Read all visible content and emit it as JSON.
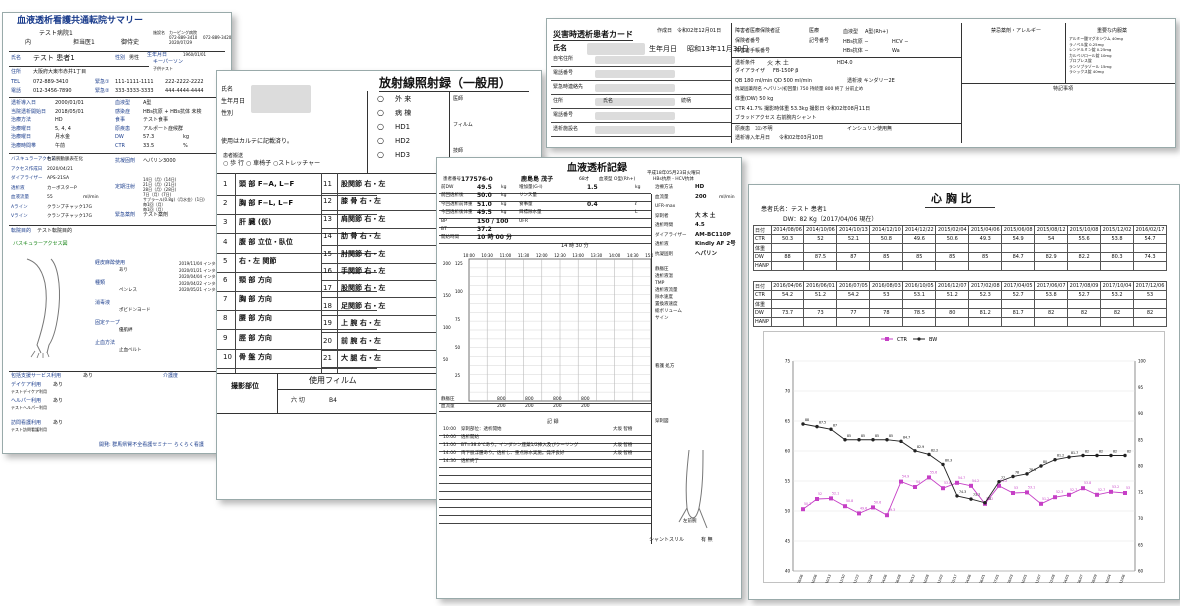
{
  "summary": {
    "title": "血液透析看護共通転院サマリー",
    "ids": [
      "フリガナ",
      "テスト病院1",
      "内",
      "担当医1",
      "御侍史"
    ],
    "hospital_label": "施設名",
    "hospital": "カーピング病院",
    "tel_label": "TEL",
    "tel": "072-889-3410",
    "fax_label": "FAX",
    "fax": "072-889-3420",
    "date_label": "記入日",
    "date": "2020/07/29",
    "writer_label": "記入者",
    "writer": "看師",
    "name_label": "氏名",
    "name": "テスト 患者1",
    "sex_label": "性別",
    "sex": "男性",
    "birth_label": "生年月日",
    "birth": "1960/01/01",
    "age": "60",
    "age_unit": "歳",
    "keyperson": "キーパーソン",
    "keyperson_val": "子供テスト",
    "address_label": "住所",
    "address": "大阪府大東市赤井1丁目",
    "tel2_label": "TEL",
    "tel2": "072-889-3410",
    "emerg_label": "緊急①",
    "emerg1": "111-1111-1111",
    "emerg1b": "222-2222-2222",
    "phone_label": "電話",
    "phone": "012-3456-7890",
    "emerg2_label": "緊急②",
    "emerg2": "333-3333-3333",
    "emerg2b": "444-4444-4444",
    "rows_left": [
      {
        "k": "透析導入日",
        "v": "2000/01/01"
      },
      {
        "k": "当院透析開始日",
        "v": "2018/05/01"
      },
      {
        "k": "治療方法",
        "v": "HD"
      },
      {
        "k": "治療曜日",
        "v": "5, 4, 4"
      },
      {
        "k": "治療曜日",
        "v": "月水金"
      },
      {
        "k": "治療時間帯",
        "v": "午前"
      }
    ],
    "rows_right": [
      {
        "k": "血液型",
        "v": "A型"
      },
      {
        "k": "感染症",
        "v": "HBs抗原 + HBs抗体 未検"
      },
      {
        "k": "食事",
        "v": "テスト食事"
      },
      {
        "k": "原疾患",
        "v": "アルポート症候群"
      },
      {
        "k": "DW",
        "v": "57.3",
        "u": "kg"
      },
      {
        "k": "CTR",
        "v": "33.5",
        "u": "%"
      }
    ],
    "access_section": [
      {
        "k": "バスキュラーアクセス",
        "v": "右前腕動脈表在化"
      },
      {
        "k": "アクセス作成日",
        "v": "2020/04/21"
      },
      {
        "k": "ダイアライザー",
        "v": "APS-21SA"
      },
      {
        "k": "透析液",
        "v": "カーボスターP"
      },
      {
        "k": "血液流量",
        "v": "55",
        "u": "ml/min"
      },
      {
        "k": "Aライン",
        "v": "クランプチャック17G"
      },
      {
        "k": "Vライン",
        "v": "クランプチャック17G"
      }
    ],
    "anticoag_label": "抗凝固剤",
    "anticoag": "ヘパリン3000",
    "fixed_label": "定期注射",
    "emerg_drug_label": "緊急薬剤",
    "emerg_drug": "テスト薬剤",
    "injections": [
      "14日（月）(14日)",
      "21日（月）(21日)",
      "28日（月）(28日)",
      "7日（月）(7日)",
      "サブラール(0.8g)（月水金）(1日)",
      "毎1回（月）",
      "毎1回（月）"
    ],
    "transfer_label": "転院目的",
    "transfer_note": "テスト転院目的",
    "vascular_label": "バスキュラーアクセス図",
    "access_list": [
      {
        "k": "経皮麻酔使用",
        "v": "あり"
      },
      {
        "k": "種類",
        "v": "ペンレス"
      },
      {
        "k": "消毒液",
        "v": "ポビドンヨード"
      },
      {
        "k": "固定テープ",
        "v": "優肌絆"
      },
      {
        "k": "止血方法",
        "v": "止血ベルト"
      }
    ],
    "access_dates": [
      "2019/11/04 インターベンショナル",
      "2020/01/21 インターベンショナル",
      "2020/04/04 インターベンショナル",
      "2020/04/22 インターベンショナル",
      "2020/05/21 インターベンショナル"
    ],
    "service_label": "包括支援サービス利用",
    "service_val": "あり",
    "care_label": "介護度",
    "day_care_label": "デイケア利用",
    "day_care_val": "あり",
    "day_care_note": "テストデイケア利用",
    "helper_label": "ヘルパー利用",
    "helper_val": "あり",
    "helper_note": "テストヘルパー利用",
    "visit_label": "訪問看護利用",
    "visit_val": "あり",
    "visit_note": "テスト訪問看護利用",
    "footer": "開発: 群馬県腎不全看護セミナー らくらく看護"
  },
  "radiation": {
    "title": "放射線照射録（一般用）",
    "labels": [
      "氏名",
      "生年月日",
      "性別"
    ],
    "note": "使用はカルテに記載済り。",
    "transport_label": "患者搬送",
    "transport": "○ 歩 行  ○ 車椅子  ○ストレッチャー",
    "options": [
      "外 来",
      "病 棟",
      "HD1",
      "HD2",
      "HD3"
    ],
    "side_labels": [
      "医師",
      "フィルム",
      "技師"
    ],
    "rows_left": [
      {
        "n": "1",
        "t": "頭 部    F−A, L−F"
      },
      {
        "n": "2",
        "t": "胸 部    F−L, L−F"
      },
      {
        "n": "3",
        "t": "肝 臓 (仮)"
      },
      {
        "n": "4",
        "t": "腹 部  立位・臥位"
      },
      {
        "n": "5",
        "t": "右・左 関節"
      },
      {
        "n": "6",
        "t": "頸 部    方向"
      },
      {
        "n": "7",
        "t": "胸 部    方向"
      },
      {
        "n": "8",
        "t": "腰 部    方向"
      },
      {
        "n": "9",
        "t": "脛 部    方向"
      },
      {
        "n": "10",
        "t": "骨 盤    方向"
      }
    ],
    "rows_right": [
      {
        "n": "11",
        "t": "股関節  右・左"
      },
      {
        "n": "12",
        "t": "膝 骨  右・左"
      },
      {
        "n": "13",
        "t": "肩関節  右・左"
      },
      {
        "n": "14",
        "t": "肋 骨  右・左"
      },
      {
        "n": "15",
        "t": "肘関節  右・左"
      },
      {
        "n": "16",
        "t": "手関節  右・左"
      },
      {
        "n": "17",
        "t": "股関節  右・左"
      },
      {
        "n": "18",
        "t": "足関節  右・左"
      },
      {
        "n": "19",
        "t": "上 腕  右・左"
      },
      {
        "n": "20",
        "t": "前 腕  右・左"
      },
      {
        "n": "21",
        "t": "大 腿  右・左"
      }
    ],
    "film_label": "使用フィルム",
    "film_sizes": [
      "六 切",
      "B4"
    ],
    "film_side": "撮影部位"
  },
  "dialysis": {
    "title": "血液透析記録",
    "date": "平成18年05月23日火曜日",
    "patient_label": "患者番号",
    "patient_id": "177576-0",
    "patient_name": "鹿島島 茂子",
    "age": "68才",
    "blood": "血液型 O型(Rh+)",
    "infect": "HBs抗原 - HCV抗体",
    "rows": [
      {
        "k": "前DW",
        "v": "49.5",
        "u": "kg"
      },
      {
        "k": "前回透析後",
        "v": "50.0",
        "u": "kg"
      },
      {
        "k": "今回透析前体重",
        "v": "51.0",
        "u": "kg"
      },
      {
        "k": "今回透析後体重",
        "v": "49.5",
        "u": "kg"
      },
      {
        "k": "BP",
        "v": "150 / 100"
      },
      {
        "k": "BT",
        "v": "37.2"
      },
      {
        "k": "開始時間",
        "v": "10 時 00 分"
      }
    ],
    "mid": [
      {
        "k": "増加量(G-I)",
        "v": "1.5",
        "u": "kg"
      },
      {
        "k": "リンス量",
        "v": "",
        "u": ""
      },
      {
        "k": "食事量",
        "v": "0.4",
        "u": "ℓ"
      },
      {
        "k": "目標除水量",
        "v": "",
        "u": "L"
      },
      {
        "k": "UFR",
        "v": "",
        "u": ""
      }
    ],
    "right": [
      {
        "k": "治療方法",
        "v": "HD"
      },
      {
        "k": "血流量",
        "v": "200",
        "u": "ml/min"
      },
      {
        "k": "UFR-max",
        "v": ""
      },
      {
        "k": "穿刺者",
        "v": "大 木 土"
      },
      {
        "k": "透析時間",
        "v": "4.5"
      },
      {
        "k": "ダイアライザー",
        "v": "AM-BC110P"
      },
      {
        "k": "透析液",
        "v": "Kindly AF 2号"
      },
      {
        "k": "抗凝固剤",
        "v": "ヘパリン"
      }
    ],
    "end_time": "14 時 30 分",
    "times": [
      "10:00",
      "10:30",
      "11:00",
      "11:30",
      "12:00",
      "12:30",
      "13:00",
      "13:30",
      "14:00",
      "14:30",
      "15:00"
    ],
    "y_ticks_bp": [
      "200",
      "150",
      "100",
      "50"
    ],
    "y_ticks_hr": [
      "125",
      "100",
      "75",
      "50",
      "25"
    ],
    "flow_label": "血流量",
    "flow": [
      "200",
      "200",
      "200",
      "200"
    ],
    "press_label": "静脈圧",
    "press": [
      "800",
      "800",
      "800",
      "800"
    ],
    "side_items": [
      "静脈圧",
      "透析液温",
      "TMP",
      "透析液流量",
      "除水速度",
      "置換液速度",
      "総ボリューム",
      "サイン"
    ],
    "record_label": "記 録",
    "records": [
      {
        "t": "10:00",
        "v": "穿刺部位：透析開始",
        "who": "大坂 智樹"
      },
      {
        "t": "10:00",
        "v": "透析開始"
      },
      {
        "t": "11:00",
        "v": "BT=38.0℃あり。インダシン座薬1/2挿入及びクーリング",
        "who": "大坂 智樹"
      },
      {
        "t": "14:00",
        "v": "両下肢浮腫あり。透析し、重点除水実施。発汗良好",
        "who": "大坂 智樹"
      },
      {
        "t": "14:30",
        "v": "透析終了"
      }
    ],
    "note_label": "看護 処方",
    "arm_label": "穿刺図",
    "arm_side": "左前腕",
    "shunt_label": "シャントスリル",
    "shunt_val": "有 無"
  },
  "emergency": {
    "title": "災害時透析患者カード",
    "created_label": "作成日",
    "created": "令和02年12月01日",
    "name_label": "氏名",
    "birth_label": "生年月日",
    "birth": "昭和13年11月30日",
    "fields": [
      "自宅住所",
      "電話番号",
      "緊急時連絡先",
      "住所",
      "電話番号",
      "透析施設名"
    ],
    "contact_name_label": "氏名",
    "relation_label": "続柄",
    "insurance": [
      {
        "k": "障害者医療保険者証",
        "v": "医療"
      },
      {
        "k": "保険者番号",
        "v": "記号番号"
      },
      {
        "k": "障害者手帳番号",
        "v": ""
      }
    ],
    "blood_label": "血液型",
    "blood": "A型(Rh+)",
    "hbs": "HBs抗原 −",
    "hcv": "HCV −",
    "hbs2": "HBs抗体 −",
    "wa": "Wa",
    "cond_label": "透析条件",
    "cond": "火 木 土",
    "hd": "HD4.0",
    "dializer_label": "ダイアライザ",
    "dializer": "FB-150P β",
    "qb": "QB 180 ml/min QD 500 ml/min",
    "dialysate": "透析液 キンダリー2E",
    "anticoag": "抗凝固薬剤名 ヘパリン(初回量) 750 持続量 800 終了 分前止め",
    "dw": "体重(DW) 50 kg",
    "ctr": "CTR 41.7% 撮影時体重 53.3kg 撮影日 令和02年08月11日",
    "access": "ブラッドアクセス 右前腕内シャント",
    "disease_label": "原疾患",
    "disease": "ｺﾛﾝ不明",
    "start_label": "透析導入年月日",
    "start": "令和02年03月10日",
    "insulin_label": "インシュリン使用",
    "insulin": "無",
    "allergy_label": "禁忌薬剤・アレルギー",
    "important_label": "重要な内服薬",
    "meds": [
      "アルミー酸マグネシウム 40mg",
      "ラノベル錠 0.25mg",
      "レンドルミン錠 0.25mg",
      "カルベジロール錠 10mg",
      "ブロプレス錠",
      "ランソプラゾール 15mg",
      "ラシックス錠 40mg"
    ],
    "special_label": "特記事項"
  },
  "ctr": {
    "title": "心 胸 比",
    "patient": "患者氏名：テスト 患者1",
    "dw": "DW：82 Kg（2017/04/06 現在）",
    "row_labels": [
      "日付",
      "CTR",
      "体重",
      "DW",
      "HANP"
    ],
    "dates1": [
      "2014/08/06",
      "2014/10/06",
      "2014/10/13",
      "2014/12/10",
      "2014/12/22",
      "2015/02/04",
      "2015/04/06",
      "2015/06/08",
      "2015/08/12",
      "2015/10/08",
      "2015/12/02",
      "2016/02/17"
    ],
    "ctr1": [
      "50.3",
      "52",
      "52.1",
      "50.8",
      "49.6",
      "50.6",
      "49.3",
      "54.9",
      "54",
      "55.6",
      "53.8",
      "54.7"
    ],
    "dw1": [
      "88",
      "87.5",
      "87",
      "85",
      "85",
      "85",
      "85",
      "84.7",
      "82.9",
      "82.2",
      "80.3",
      "74.3"
    ],
    "dates2": [
      "2016/04/06",
      "2016/06/01",
      "2016/07/05",
      "2016/08/03",
      "2016/10/05",
      "2016/12/07",
      "2017/02/08",
      "2017/04/05",
      "2017/06/07",
      "2017/08/09",
      "2017/10/04",
      "2017/12/06"
    ],
    "ctr2": [
      "54.2",
      "51.2",
      "54.2",
      "53",
      "53.1",
      "51.2",
      "52.3",
      "52.7",
      "53.8",
      "52.7",
      "53.2",
      "53"
    ],
    "dw2": [
      "73.7",
      "73",
      "77",
      "78",
      "78.5",
      "80",
      "81.2",
      "81.7",
      "82",
      "82",
      "82",
      "82"
    ],
    "legend_ctr": "CTR",
    "legend_bw": "BW",
    "chart_data": {
      "type": "line",
      "series": [
        {
          "name": "CTR",
          "values": [
            50.3,
            52,
            52.1,
            50.8,
            49.6,
            50.6,
            49.3,
            54.9,
            54,
            55.6,
            53.8,
            54.7,
            54.2,
            51.2,
            54.2,
            53,
            53.1,
            51.2,
            52.3,
            52.7,
            53.8,
            52.7,
            53.2,
            53
          ]
        },
        {
          "name": "BW",
          "values": [
            88,
            87.5,
            87,
            85,
            85,
            85,
            85,
            84.7,
            82.9,
            82.2,
            80.3,
            74.3,
            73.7,
            73,
            77,
            78,
            78.5,
            80,
            81.2,
            81.7,
            82,
            82,
            82,
            82
          ]
        }
      ],
      "ylim_left": [
        40,
        75
      ],
      "ylim_right": [
        60,
        100
      ]
    }
  }
}
